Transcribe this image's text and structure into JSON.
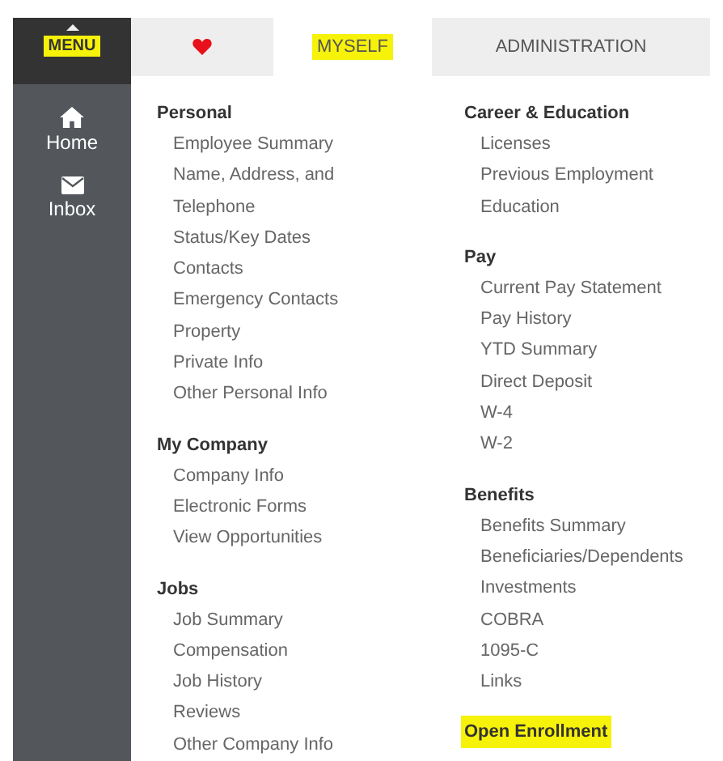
{
  "sidebar": {
    "menu": {
      "label": "MENU",
      "highlighted": true
    },
    "items": [
      {
        "label": "Home",
        "kind": "home"
      },
      {
        "label": "Inbox",
        "kind": "mail"
      }
    ]
  },
  "tabs": [
    {
      "kind": "favorites",
      "selected": false
    },
    {
      "kind": "text",
      "label": "MYSELF",
      "selected": true,
      "highlighted": true
    },
    {
      "kind": "text",
      "label": "ADMINISTRATION",
      "selected": false,
      "highlighted": false
    }
  ],
  "columns": [
    [
      {
        "heading": "Personal",
        "highlighted": false,
        "items": [
          "Employee Summary",
          "Name, Address, and Telephone",
          "Status/Key Dates",
          "Contacts",
          "Emergency Contacts",
          "Property",
          "Private Info",
          "Other Personal Info"
        ]
      },
      {
        "heading": "My Company",
        "highlighted": false,
        "items": [
          "Company Info",
          "Electronic Forms",
          "View Opportunities"
        ]
      },
      {
        "heading": "Jobs",
        "highlighted": false,
        "items": [
          "Job Summary",
          "Compensation",
          "Job History",
          "Reviews",
          "Other Company Info"
        ]
      }
    ],
    [
      {
        "heading": "Career & Education",
        "highlighted": false,
        "items": [
          "Licenses",
          "Previous Employment",
          "Education"
        ]
      },
      {
        "heading": "Pay",
        "highlighted": false,
        "items": [
          "Current Pay Statement",
          "Pay History",
          "YTD Summary",
          "Direct Deposit",
          "W-4",
          "W-2"
        ]
      },
      {
        "heading": "Benefits",
        "highlighted": false,
        "items": [
          "Benefits Summary",
          "Beneficiaries/Dependents",
          "Investments",
          "COBRA",
          "1095-C",
          "Links"
        ]
      },
      {
        "heading": "Open Enrollment",
        "highlighted": true
      }
    ]
  ]
}
